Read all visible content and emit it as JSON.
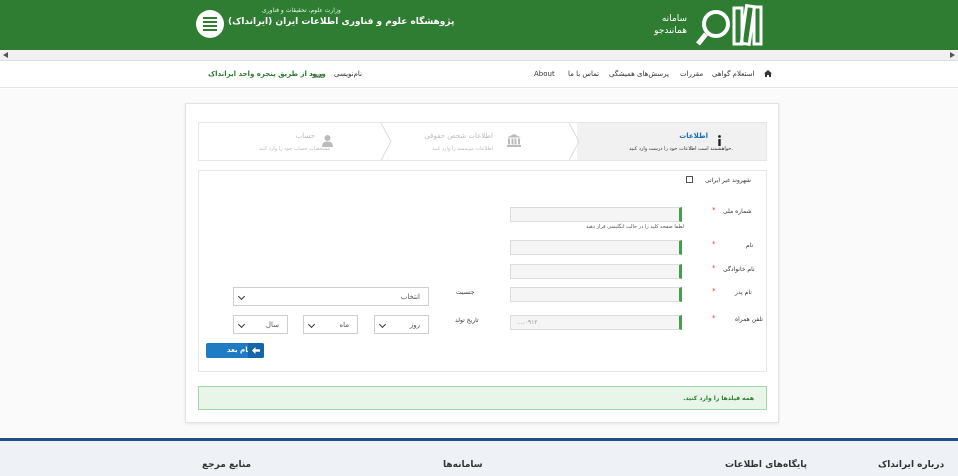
{
  "header": {
    "title_line1": "سامانه",
    "title_line2": "همانندجو",
    "org_ministry": "وزارت علوم، تحقیقات و فناوری",
    "org_name": "پژوهشگاه علوم و فناوری اطلاعات ایران (ایرانداک)"
  },
  "nav": {
    "inquiry": "استعلام گواهی",
    "rules": "مقررات",
    "faq": "پرسش‌های همیشگی",
    "contact": "تماس با ما",
    "about": "About",
    "register": "نام‌نویسی",
    "login": "ورود",
    "login_single_window": "ورود از طریق پنجره واحد ایرانداک"
  },
  "steps": [
    {
      "title": "اطلاعات",
      "desc": "خواهشمند است اطلاعات خود را درست وارد کنید."
    },
    {
      "title": "اطلاعات شخص حقوقی",
      "desc": "اطلاعات موسسه را وارد کنید"
    },
    {
      "title": "حساب",
      "desc": "مشخصات حساب خود را وارد کنید"
    }
  ],
  "form": {
    "foreign_citizen": "شهروند غیر ایرانی",
    "national_id_label": "شماره ملی",
    "national_id_hint": "لطفا صفحه کلید را در حالت انگلیسی قرار دهید",
    "first_name_label": "نام",
    "last_name_label": "نام خانوادگی",
    "father_name_label": "نام پدر",
    "mobile_label": "تلفن همراه",
    "mobile_placeholder": "....۰۹۱۲",
    "gender_label": "جنسیت",
    "gender_value": "انتخاب",
    "birth_label": "تاریخ تولد",
    "day_value": "روز",
    "month_value": "ماه",
    "year_value": "سال",
    "required_mark": "*",
    "next_button": "گام بعد"
  },
  "alert": "همه فیلدها را وارد کنید.",
  "footer": {
    "about_irandoc": "درباره ایرانداک",
    "databases": "پایگاه‌های اطلاعات",
    "systems": "سامانه‌ها",
    "references": "منابع مرجع"
  },
  "colors": {
    "brand_green": "#2e7d32",
    "primary_blue": "#1f7bc4",
    "required_red": "#e53935"
  }
}
